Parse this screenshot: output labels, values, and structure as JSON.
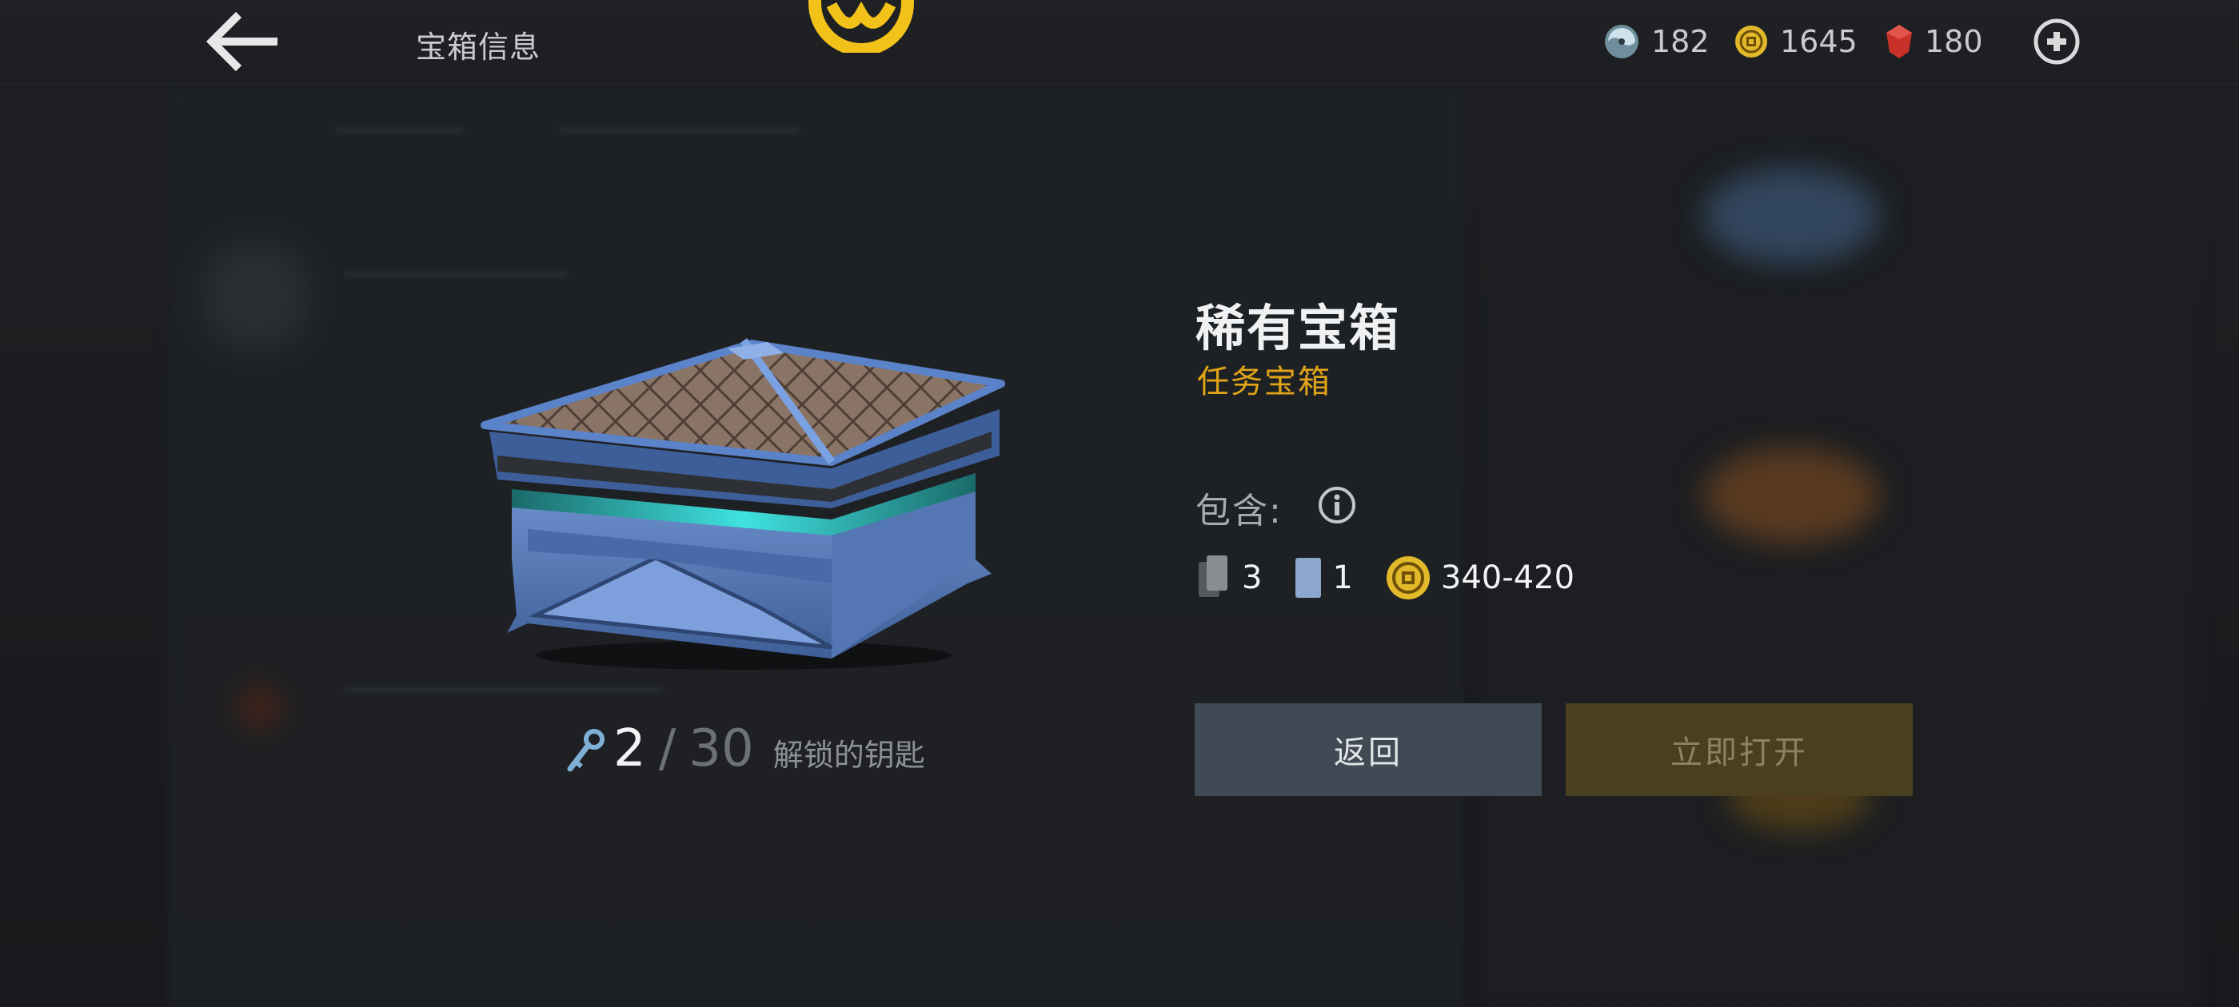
{
  "header": {
    "title": "宝箱信息"
  },
  "currencies": [
    {
      "icon": "swirl-token-icon",
      "value": "182",
      "color": "#8fb3c4"
    },
    {
      "icon": "gold-coin-icon",
      "value": "1645",
      "color": "#e2b92a"
    },
    {
      "icon": "red-gem-icon",
      "value": "180",
      "color": "#c8302a"
    }
  ],
  "chest": {
    "name": "稀有宝箱",
    "type": "任务宝箱",
    "contains_label": "包含:",
    "contents": {
      "cards_count": "3",
      "rare_card_count": "1",
      "coins_range": "340-420"
    },
    "keys": {
      "current": "2",
      "separator": "/",
      "required": "30",
      "label": "解锁的钥匙"
    }
  },
  "buttons": {
    "back_label": "返回",
    "open_label": "立即打开"
  },
  "colors": {
    "accent_gold": "#e2a417",
    "back_button": "#3f4a55",
    "open_button_disabled": "#4a3f1e"
  }
}
